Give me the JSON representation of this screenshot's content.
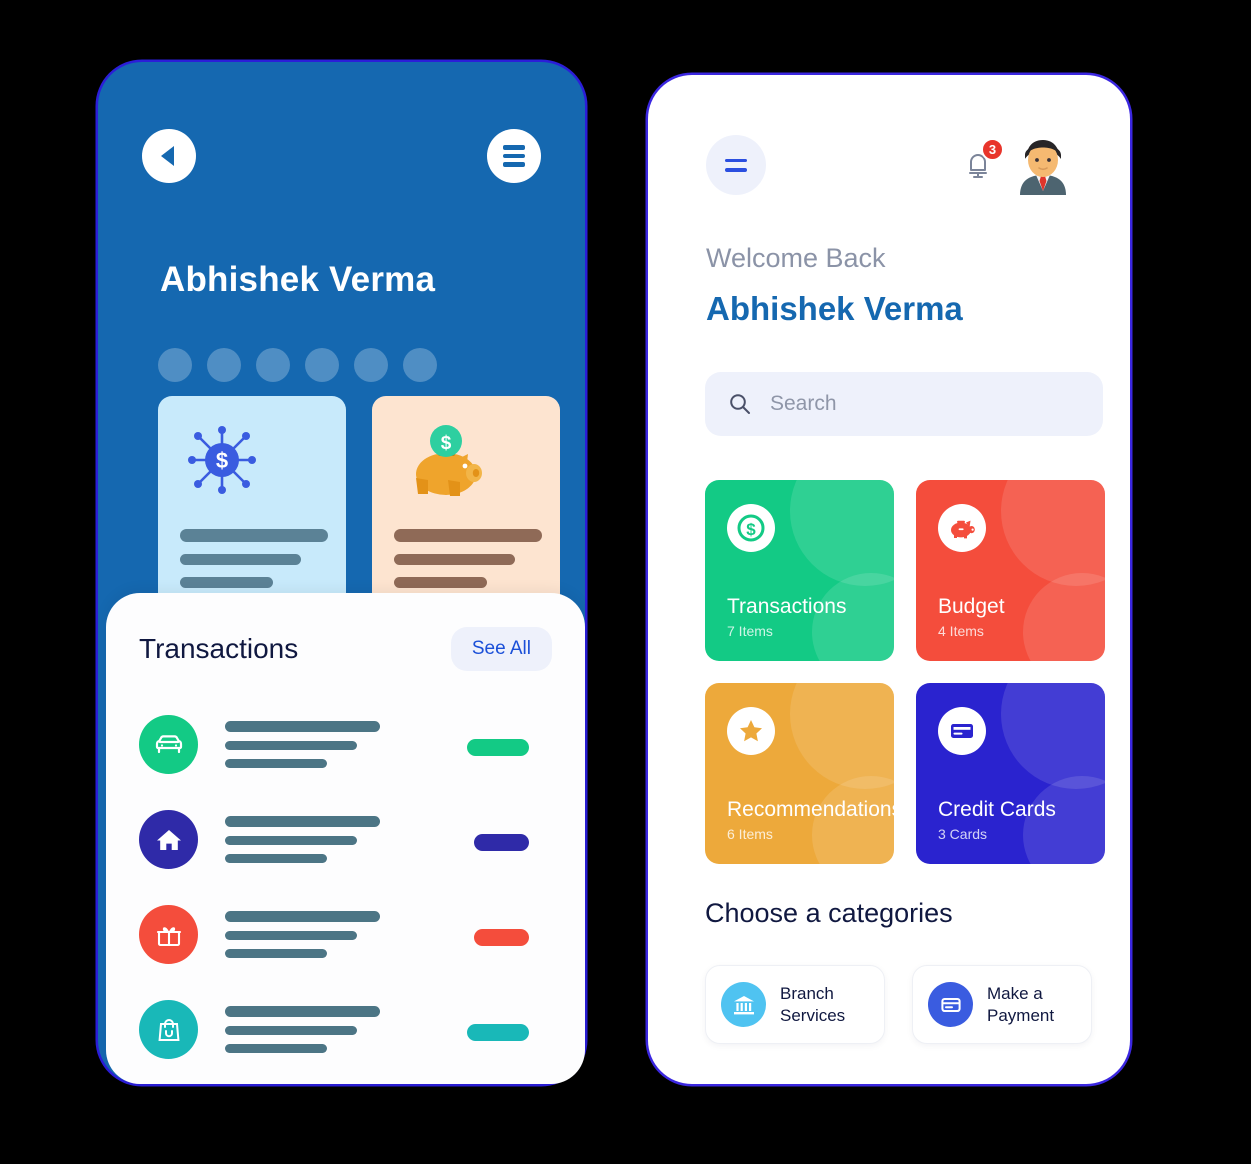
{
  "theme": {
    "brand_blue": "#1568b0",
    "accent_indigo": "#2b4fe0",
    "green": "#13ca85",
    "red": "#f44d3c",
    "amber": "#eda93b",
    "blue_violet": "#2a23cf",
    "teal": "#19b8b8",
    "page_background": "#000000"
  },
  "left_phone": {
    "topbar": {
      "back_label": "Back",
      "menu_label": "Menu"
    },
    "title": "Abhishek Verma",
    "pager_dots": 6,
    "promos": [
      {
        "name": "money-network-card",
        "icon": "dollar-network-icon",
        "theme": "blue"
      },
      {
        "name": "savings-card",
        "icon": "piggy-bank-icon",
        "theme": "peach"
      }
    ],
    "transactions_panel": {
      "title": "Transactions",
      "see_all_label": "See All",
      "rows": [
        {
          "icon": "car-icon",
          "color": "#13ca85",
          "amount_color": "#13ca85",
          "amount_width": "wide"
        },
        {
          "icon": "home-icon",
          "color": "#2f2aa8",
          "amount_color": "#2f2aa8",
          "amount_width": "narrow"
        },
        {
          "icon": "gift-icon",
          "color": "#f44d3c",
          "amount_color": "#f44d3c",
          "amount_width": "narrow"
        },
        {
          "icon": "shopping-bag-icon",
          "color": "#19b8b8",
          "amount_color": "#19b8b8",
          "amount_width": "wide"
        }
      ]
    }
  },
  "right_phone": {
    "topbar": {
      "menu_label": "Menu",
      "notification_count": "3",
      "avatar_label": "Abhishek Verma"
    },
    "greeting": "Welcome Back",
    "user_name": "Abhishek Verma",
    "search": {
      "placeholder": "Search",
      "value": ""
    },
    "tiles": [
      {
        "title": "Transactions",
        "subtitle": "7 Items",
        "icon": "dollar-circle-icon",
        "color": "#13ca85",
        "icon_color": "#13ca85"
      },
      {
        "title": "Budget",
        "subtitle": "4 Items",
        "icon": "piggy-bank-icon",
        "color": "#f44d3c",
        "icon_color": "#f44d3c"
      },
      {
        "title": "Recommendations",
        "subtitle": "6 Items",
        "icon": "star-icon",
        "color": "#eda93b",
        "icon_color": "#eda93b"
      },
      {
        "title": "Credit Cards",
        "subtitle": "3 Cards",
        "icon": "credit-card-icon",
        "color": "#2a23cf",
        "icon_color": "#2a23cf"
      }
    ],
    "categories_heading": "Choose a categories",
    "categories": [
      {
        "label": "Branch\nServices",
        "line1": "Branch",
        "line2": "Services",
        "icon": "bank-icon",
        "color": "#4fc3f1"
      },
      {
        "label": "Make a\nPayment",
        "line1": "Make a",
        "line2": "Payment",
        "icon": "credit-card-icon",
        "color": "#3a5ce0"
      }
    ]
  }
}
